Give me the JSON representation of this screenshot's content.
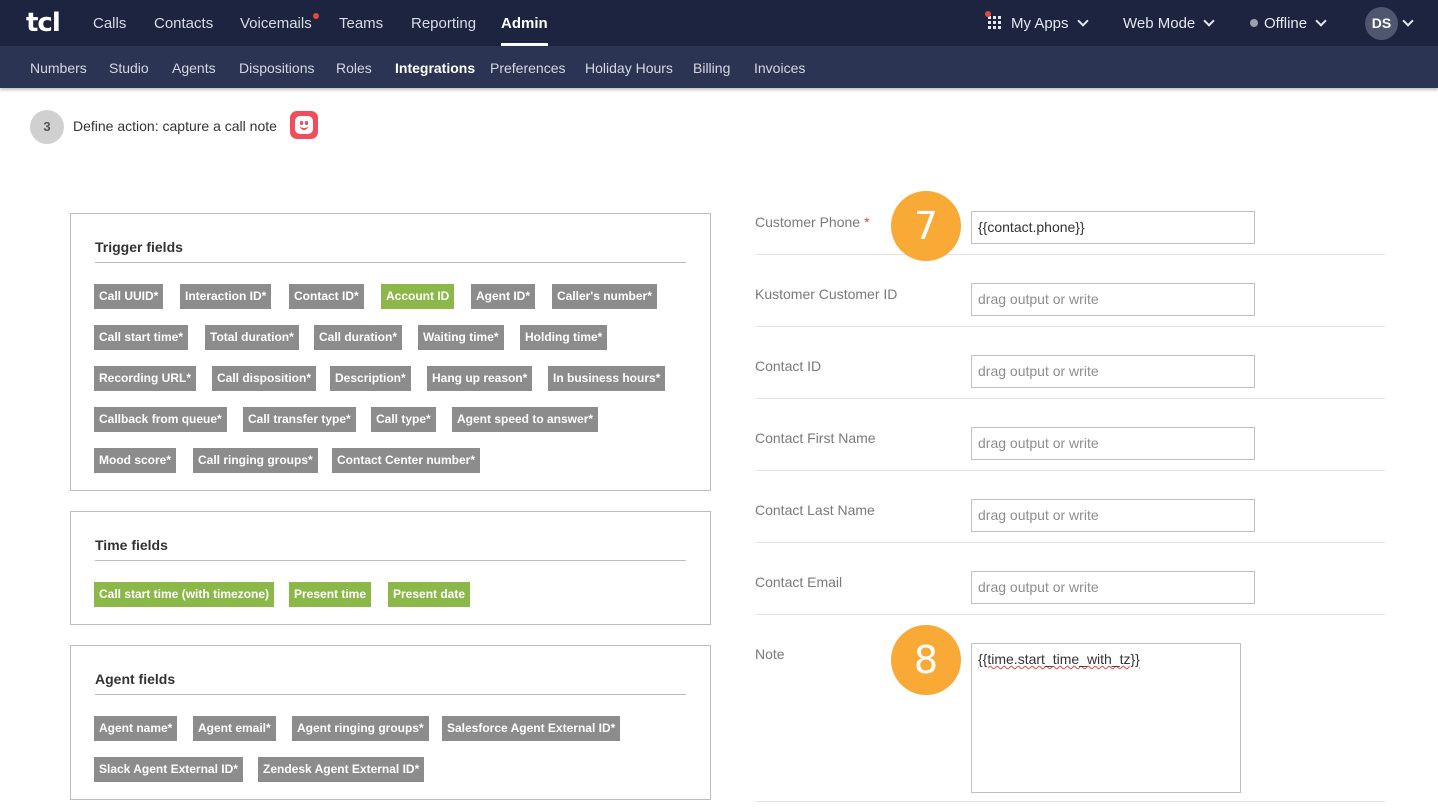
{
  "app": {
    "logo": "tcl"
  },
  "topnav": [
    {
      "label": "Calls"
    },
    {
      "label": "Contacts"
    },
    {
      "label": "Voicemails"
    },
    {
      "label": "Teams"
    },
    {
      "label": "Reporting"
    },
    {
      "label": "Admin"
    }
  ],
  "top_right": {
    "my_apps": "My Apps",
    "web_mode": "Web Mode",
    "status": "Offline",
    "avatar_initials": "DS"
  },
  "subnav": [
    {
      "label": "Numbers"
    },
    {
      "label": "Studio"
    },
    {
      "label": "Agents"
    },
    {
      "label": "Dispositions"
    },
    {
      "label": "Roles"
    },
    {
      "label": "Integrations"
    },
    {
      "label": "Preferences"
    },
    {
      "label": "Holiday Hours"
    },
    {
      "label": "Billing"
    },
    {
      "label": "Invoices"
    }
  ],
  "step": {
    "number": "3",
    "text": "Define action: capture a call note"
  },
  "trigger_fields": {
    "title": "Trigger fields",
    "tags": [
      "Call UUID*",
      "Interaction ID*",
      "Contact ID*",
      "Account ID",
      "Agent ID*",
      "Caller's number*",
      "Call start time*",
      "Total duration*",
      "Call duration*",
      "Waiting time*",
      "Holding time*",
      "Recording URL*",
      "Call disposition*",
      "Description*",
      "Hang up reason*",
      "In business hours*",
      "Callback from queue*",
      "Call transfer type*",
      "Call type*",
      "Agent speed to answer*",
      "Mood score*",
      "Call ringing groups*",
      "Contact Center number*"
    ]
  },
  "time_fields": {
    "title": "Time fields",
    "tags": [
      "Call start time (with timezone)",
      "Present time",
      "Present date"
    ]
  },
  "agent_fields": {
    "title": "Agent fields",
    "tags": [
      "Agent name*",
      "Agent email*",
      "Agent ringing groups*",
      "Salesforce Agent External ID*",
      "Slack Agent External ID*",
      "Zendesk Agent External ID*"
    ]
  },
  "form": {
    "customer_phone": {
      "label": "Customer Phone",
      "required": "*",
      "value": "{{contact.phone}}"
    },
    "kustomer_customer_id": {
      "label": "Kustomer Customer ID",
      "placeholder": "drag output or write"
    },
    "contact_id": {
      "label": "Contact ID",
      "placeholder": "drag output or write"
    },
    "contact_first_name": {
      "label": "Contact First Name",
      "placeholder": "drag output or write"
    },
    "contact_last_name": {
      "label": "Contact Last Name",
      "placeholder": "drag output or write"
    },
    "contact_email": {
      "label": "Contact Email",
      "placeholder": "drag output or write"
    },
    "note": {
      "label": "Note",
      "value": "{{time.start_time_with_tz}}"
    }
  },
  "badges": {
    "seven": "7",
    "eight": "8"
  },
  "colors": {
    "topbar": "#1c2440",
    "subbar": "#2b3452",
    "tag_gray": "#8c8c8c",
    "tag_green": "#8bb849",
    "badge": "#f9a935"
  }
}
